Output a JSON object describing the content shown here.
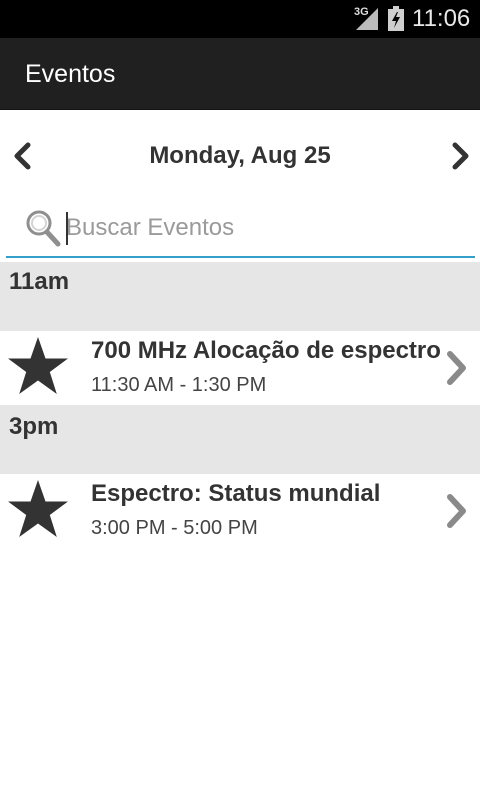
{
  "status_bar": {
    "network": "3G",
    "time": "11:06",
    "icons": [
      "signal-icon",
      "battery-icon"
    ]
  },
  "action_bar": {
    "title": "Eventos"
  },
  "date_nav": {
    "date": "Monday, Aug 25",
    "prev_icon": "chevron-left-icon",
    "next_icon": "chevron-right-icon"
  },
  "search": {
    "placeholder": "Buscar Eventos",
    "value": "",
    "icon": "search-icon"
  },
  "sections": [
    {
      "header": "11am",
      "events": [
        {
          "title": "700 MHz Alocação de espectro",
          "time": "11:30 AM - 1:30 PM",
          "icon": "star-icon"
        }
      ]
    },
    {
      "header": "3pm",
      "events": [
        {
          "title": "Espectro: Status mundial",
          "time": "3:00 PM - 5:00 PM",
          "icon": "star-icon"
        }
      ]
    }
  ],
  "colors": {
    "accent": "#33a0c9",
    "action_bar": "#202020",
    "section_header": "#e6e6e6",
    "text": "#333333"
  }
}
